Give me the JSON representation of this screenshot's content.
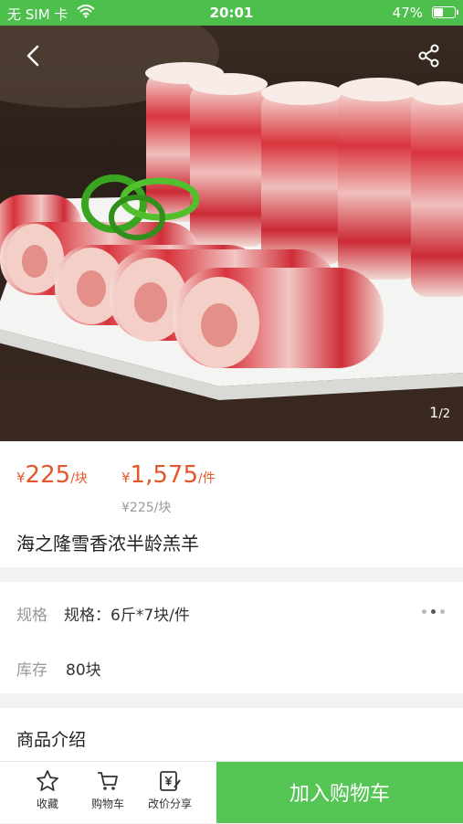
{
  "status_bar": {
    "carrier": "无 SIM 卡",
    "time": "20:01",
    "battery_percent": "47%",
    "battery_level": 0.47
  },
  "gallery": {
    "current": "1",
    "total": "/2"
  },
  "prices": [
    {
      "currency": "¥",
      "amount": "225",
      "unit": "/块"
    },
    {
      "currency": "¥",
      "amount": "1,575",
      "unit": "/件"
    }
  ],
  "original_price": "¥225/块",
  "product": {
    "title": "海之隆雪香浓半龄羔羊"
  },
  "spec": {
    "label": "规格",
    "value": "规格：6斤*7块/件"
  },
  "stock": {
    "label": "库存",
    "value": "80块"
  },
  "intro": {
    "title": "商品介绍"
  },
  "toolbar": {
    "favorite": "收藏",
    "cart": "购物车",
    "share": "改价分享",
    "add_to_cart": "加入购物车"
  },
  "colors": {
    "accent_green": "#55c655",
    "status_green": "#4cbf4c",
    "price_orange": "#e1592a"
  },
  "icons": [
    "back-icon",
    "share-icon",
    "star-icon",
    "cart-icon",
    "edit-price-icon",
    "wifi-icon",
    "battery-icon"
  ]
}
